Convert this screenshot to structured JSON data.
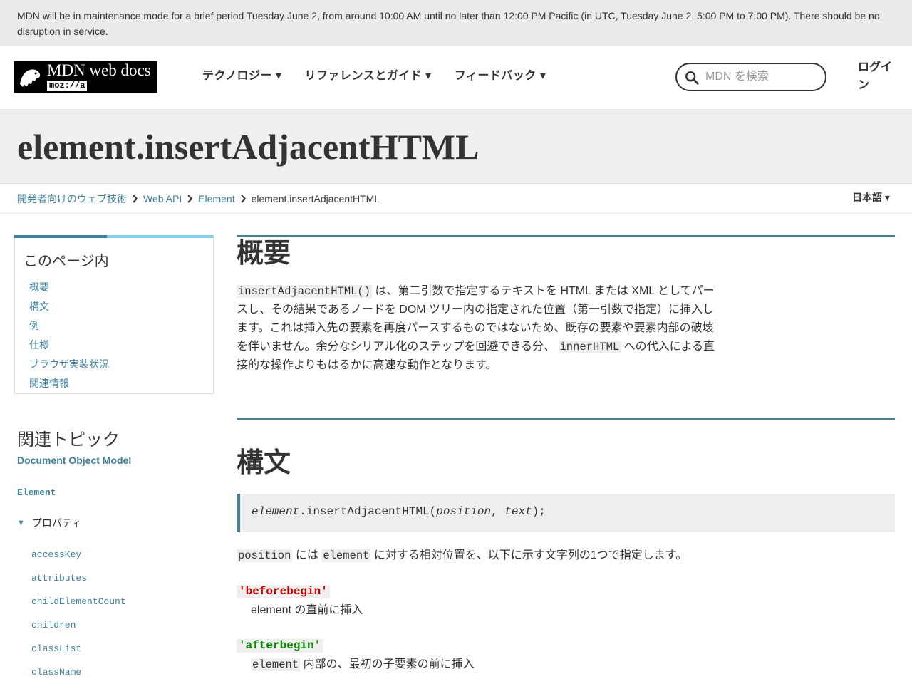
{
  "banner": {
    "text": "MDN will be in maintenance mode for a brief period Tuesday June 2, from around 10:00 AM until no later than 12:00 PM Pacific (in UTC, Tuesday June 2, 5:00 PM to 7:00 PM). There should be no disruption in service."
  },
  "header": {
    "logo_title": "MDN web docs",
    "logo_sub": "moz://a",
    "nav": [
      {
        "label": "テクノロジー ▾"
      },
      {
        "label": "リファレンスとガイド ▾"
      },
      {
        "label": "フィードバック ▾"
      }
    ],
    "search_placeholder": "MDN を検索",
    "login_label": "ログイン"
  },
  "page_title": "element.insertAdjacentHTML",
  "breadcrumb": [
    {
      "label": "開発者向けのウェブ技術"
    },
    {
      "label": "Web API"
    },
    {
      "label": "Element"
    }
  ],
  "breadcrumb_current": "element.insertAdjacentHTML",
  "language_label": "日本語 ▾",
  "toc": {
    "heading": "このページ内",
    "items": [
      "概要",
      "構文",
      "例",
      "仕様",
      "ブラウザ実装状況",
      "関連情報"
    ]
  },
  "related": {
    "heading": "関連トピック",
    "dom_link": "Document Object Model",
    "element_link": "Element",
    "properties_label": "プロパティ",
    "properties": [
      "accessKey",
      "attributes",
      "childElementCount",
      "children",
      "classList",
      "className"
    ]
  },
  "main": {
    "section1_title": "概要",
    "intro_code1": "insertAdjacentHTML()",
    "intro_text1": " は、第二引数で指定するテキストを HTML または XML としてパースし、その結果であるノードを DOM ツリー内の指定された位置（第一引数で指定）に挿入します。これは挿入先の要素を再度パースするものではないため、既存の要素や要素内部の破壊を伴いません。余分なシリアル化のステップを回避できる分、 ",
    "intro_code2": "innerHTML",
    "intro_text2": " への代入による直接的な操作よりもはるかに高速な動作となります。",
    "section2_title": "構文",
    "syntax": {
      "obj": "element",
      "method": ".insertAdjacentHTML(",
      "arg1": "position",
      "comma": ", ",
      "arg2": "text",
      "end": ");"
    },
    "pos_code1": "position",
    "pos_text1": " には ",
    "pos_code2": "element",
    "pos_text2": " に対する相対位置を、以下に示す文字列の1つで指定します。",
    "terms": [
      {
        "term": "'beforebegin'",
        "desc": "element の直前に挿入"
      },
      {
        "term": "'afterbegin'",
        "desc_code": "element",
        "desc": " 内部の、最初の子要素の前に挿入"
      }
    ]
  }
}
